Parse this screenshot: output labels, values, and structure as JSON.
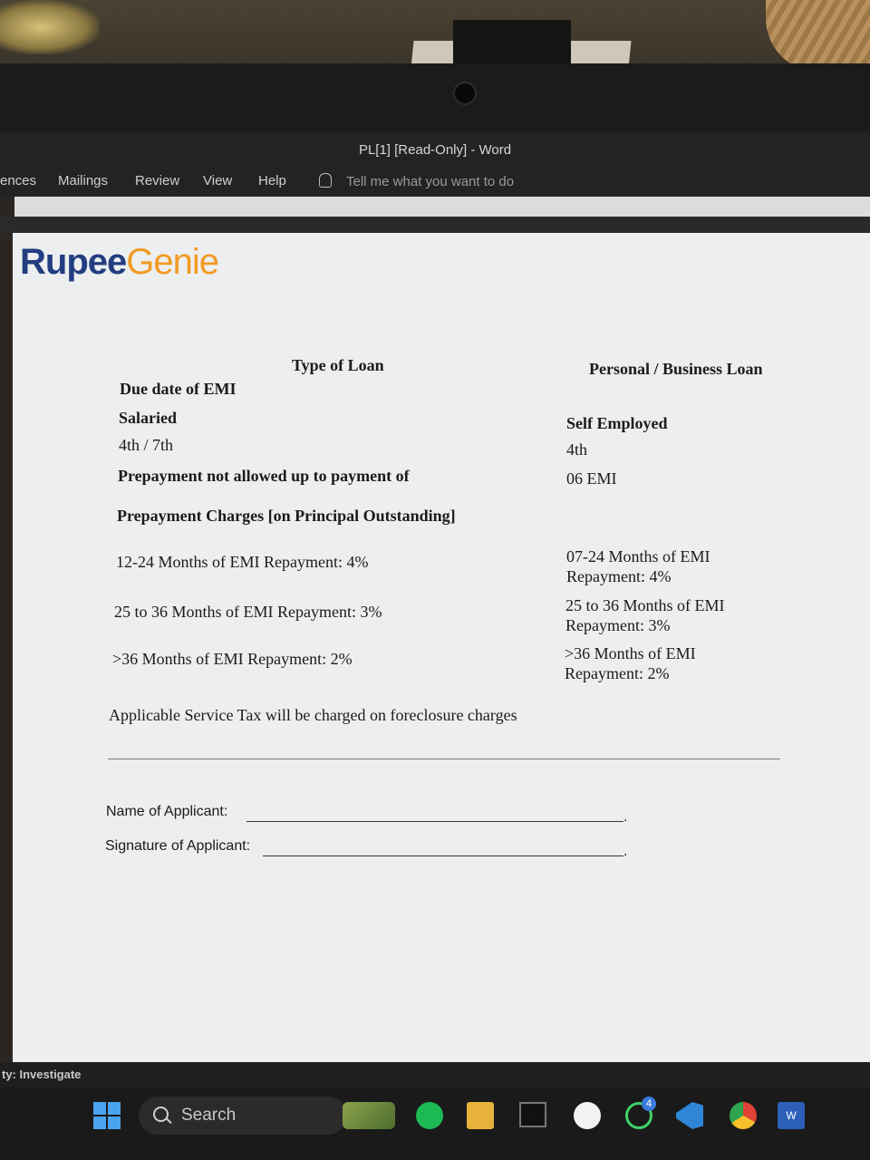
{
  "window": {
    "title": "PL[1] [Read-Only]  -  Word"
  },
  "ribbon": {
    "tabs": [
      "ences",
      "Mailings",
      "Review",
      "View",
      "Help"
    ],
    "tell_me": "Tell me what you want to do"
  },
  "document": {
    "logo": {
      "part1": "Rupee",
      "part2": "Genie"
    },
    "type_of_loan": "Type of Loan",
    "loan_kind": "Personal / Business Loan",
    "due_date_label": "Due date of EMI",
    "salaried": "Salaried",
    "self_employed": "Self Employed",
    "due_salaried": "4th / 7th",
    "due_self": "4th",
    "prepay_not_allowed": "Prepayment not allowed up to payment of",
    "prepay_emi": "06 EMI",
    "prepay_charges_heading": "Prepayment Charges [on Principal Outstanding]",
    "salaried_charges": [
      "12-24 Months of EMI Repayment: 4%",
      "25 to 36 Months of EMI Repayment: 3%",
      ">36 Months of EMI Repayment: 2%"
    ],
    "self_charges": [
      "07-24 Months of EMI Repayment: 4%",
      "25 to 36 Months of EMI Repayment: 3%",
      ">36 Months of EMI Repayment: 2%"
    ],
    "service_tax_note": "Applicable Service Tax will be charged on foreclosure charges",
    "name_label": "Name of Applicant:",
    "signature_label": "Signature of Applicant:",
    "field_end": "."
  },
  "status_bar": {
    "text": "ty: Investigate"
  },
  "taskbar": {
    "search_label": "Search",
    "whatsapp_badge": "4",
    "word_letter": "W"
  }
}
